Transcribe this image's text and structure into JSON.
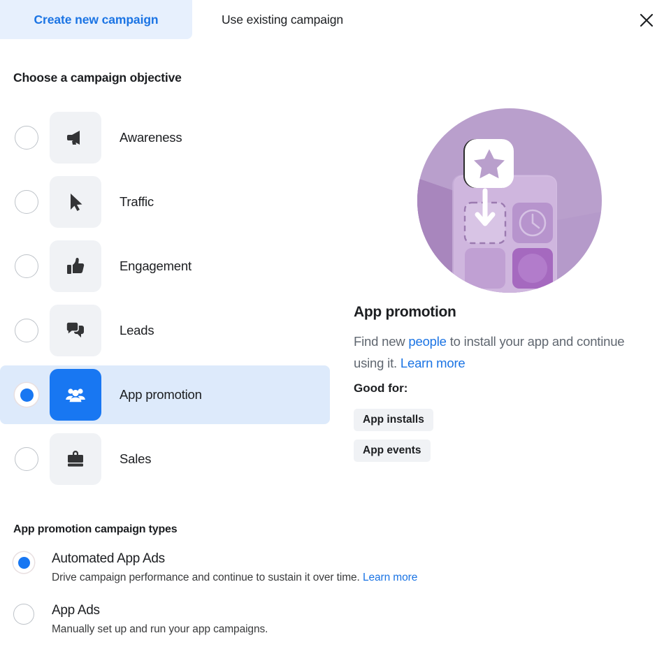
{
  "tabs": [
    {
      "label": "Create new campaign",
      "active": true
    },
    {
      "label": "Use existing campaign",
      "active": false
    }
  ],
  "close": {
    "icon": "close-icon",
    "label": "Close"
  },
  "objective_section": {
    "title": "Choose a campaign objective",
    "items": [
      {
        "label": "Awareness",
        "icon": "megaphone-icon",
        "selected": false
      },
      {
        "label": "Traffic",
        "icon": "cursor-icon",
        "selected": false
      },
      {
        "label": "Engagement",
        "icon": "thumbs-up-icon",
        "selected": false
      },
      {
        "label": "Leads",
        "icon": "chat-bubble-icon",
        "selected": false
      },
      {
        "label": "App promotion",
        "icon": "people-icon",
        "selected": true
      },
      {
        "label": "Sales",
        "icon": "briefcase-icon",
        "selected": false
      }
    ]
  },
  "detail": {
    "illustration": "app-promotion-illustration",
    "title": "App promotion",
    "desc_part1": "Find new ",
    "desc_link1": "people",
    "desc_part2": " to install your app and continue using it. ",
    "desc_link2": "Learn more",
    "good_for_label": "Good for:",
    "tags": [
      "App installs",
      "App events"
    ]
  },
  "campaign_types_section": {
    "title": "App promotion campaign types",
    "items": [
      {
        "name": "Automated App Ads",
        "desc": "Drive campaign performance and continue to sustain it over time. ",
        "link": "Learn more",
        "selected": true
      },
      {
        "name": "App Ads",
        "desc": "Manually set up and run your app campaigns.",
        "link": "",
        "selected": false
      }
    ]
  },
  "colors": {
    "accent_blue": "#1877f2",
    "link_blue": "#1b74e4",
    "tab_active_bg": "#e7f0fd",
    "row_selected_bg": "#ddeafb",
    "tile_bg": "#f0f2f5",
    "illustration_purple": "#b99fcc"
  }
}
